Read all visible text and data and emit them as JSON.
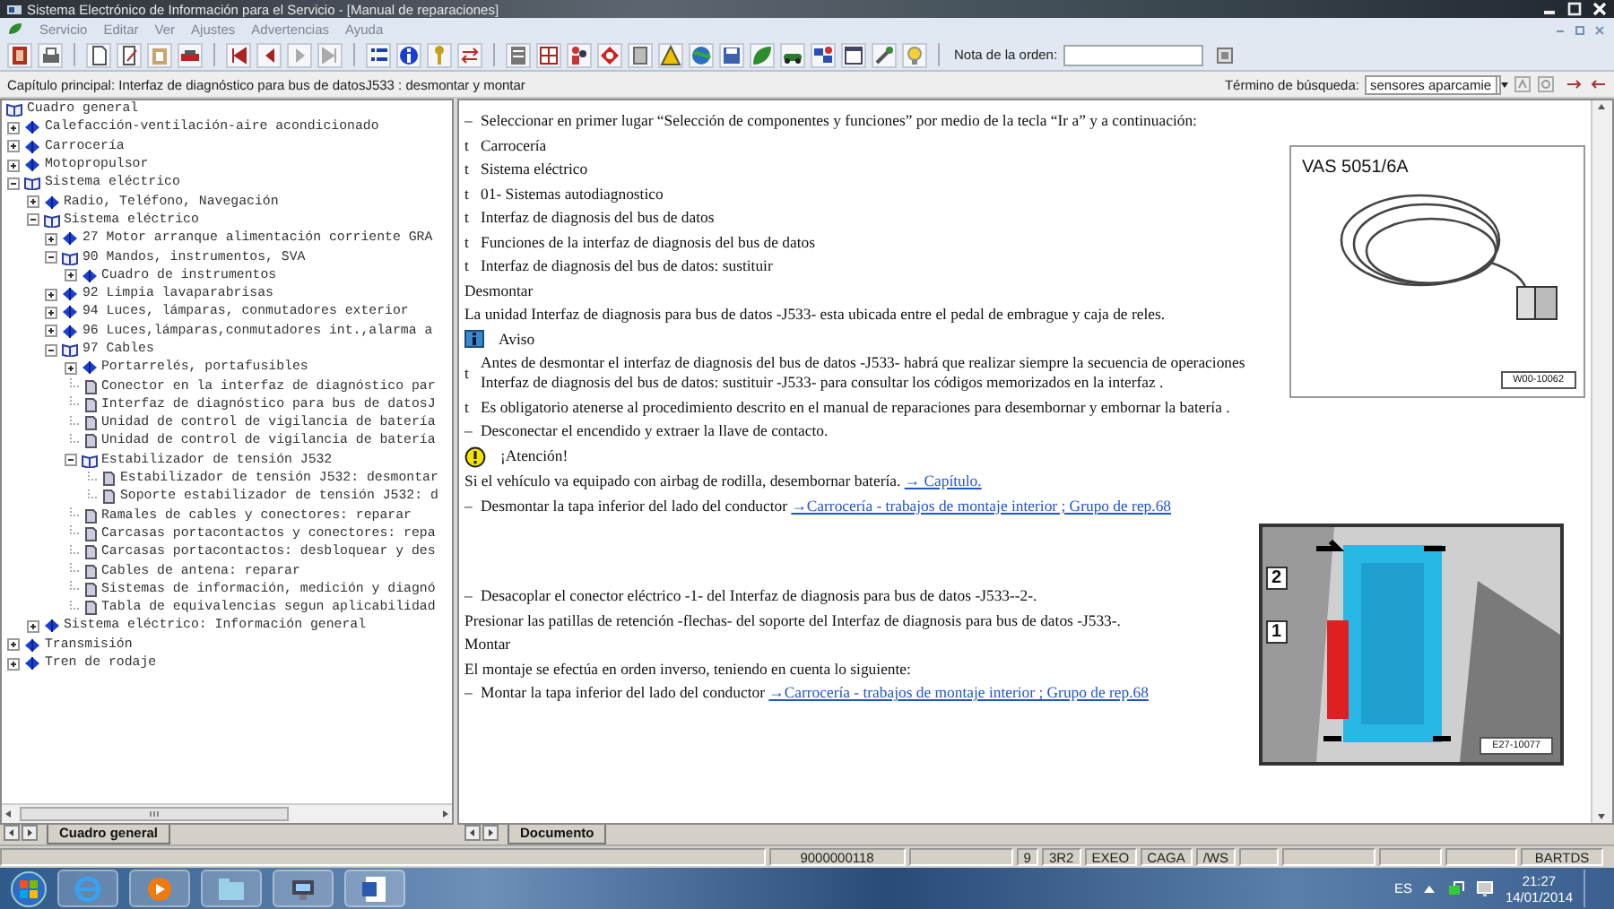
{
  "window": {
    "title": "Sistema Electrónico de Información para el Servicio - [Manual de reparaciones]"
  },
  "menu": [
    "Servicio",
    "Editar",
    "Ver",
    "Ajustes",
    "Advertencias",
    "Ayuda"
  ],
  "toolbar": {
    "order_note_label": "Nota de la orden:"
  },
  "chapter_bar": {
    "text": "Capítulo principal: Interfaz de diagnóstico para bus de datosJ533 : desmontar y montar",
    "search_label": "Término de búsqueda:",
    "search_value": "sensores aparcamie"
  },
  "tree": [
    {
      "label": "Cuadro general",
      "kind": "folder",
      "expanded": true,
      "children": [
        {
          "label": "Calefacción-ventilación-aire acondicionado",
          "kind": "folder",
          "expanded": false
        },
        {
          "label": "Carrocería",
          "kind": "folder",
          "expanded": false
        },
        {
          "label": "Motopropulsor",
          "kind": "folder",
          "expanded": false
        },
        {
          "label": "Sistema eléctrico",
          "kind": "folder",
          "expanded": true,
          "children": [
            {
              "label": "Radio, Teléfono, Navegación",
              "kind": "folder",
              "expanded": false
            },
            {
              "label": "Sistema eléctrico",
              "kind": "folder",
              "expanded": true,
              "children": [
                {
                  "label": "27 Motor arranque alimentación corriente GRA",
                  "kind": "folder",
                  "expanded": false
                },
                {
                  "label": "90 Mandos, instrumentos, SVA",
                  "kind": "folder",
                  "expanded": true,
                  "children": [
                    {
                      "label": "Cuadro de instrumentos",
                      "kind": "folder",
                      "expanded": false
                    }
                  ]
                },
                {
                  "label": "92 Limpia lavaparabrisas",
                  "kind": "folder",
                  "expanded": false
                },
                {
                  "label": "94 Luces, lámparas, conmutadores exterior",
                  "kind": "folder",
                  "expanded": false
                },
                {
                  "label": "96 Luces,lámparas,conmutadores int.,alarma a",
                  "kind": "folder",
                  "expanded": false
                },
                {
                  "label": "97 Cables",
                  "kind": "folder",
                  "expanded": true,
                  "children": [
                    {
                      "label": "Portarrelés, portafusibles",
                      "kind": "folder",
                      "expanded": false
                    },
                    {
                      "label": "Conector en la interfaz de diagnóstico par",
                      "kind": "page"
                    },
                    {
                      "label": "Interfaz de diagnóstico para bus de datosJ",
                      "kind": "page"
                    },
                    {
                      "label": "Unidad de control de vigilancia de batería",
                      "kind": "page"
                    },
                    {
                      "label": "Unidad de control de vigilancia de batería",
                      "kind": "page"
                    },
                    {
                      "label": "Estabilizador de tensión J532",
                      "kind": "folder",
                      "expanded": true,
                      "children": [
                        {
                          "label": "Estabilizador de tensión J532: desmontar",
                          "kind": "page"
                        },
                        {
                          "label": "Soporte estabilizador de tensión J532: d",
                          "kind": "page"
                        }
                      ]
                    },
                    {
                      "label": "Ramales de cables y conectores: reparar",
                      "kind": "page"
                    },
                    {
                      "label": "Carcasas portacontactos y conectores: repa",
                      "kind": "page"
                    },
                    {
                      "label": "Carcasas portacontactos: desbloquear y des",
                      "kind": "page"
                    },
                    {
                      "label": "Cables de antena: reparar",
                      "kind": "page"
                    },
                    {
                      "label": "Sistemas de información, medición y diagnó",
                      "kind": "page"
                    },
                    {
                      "label": "Tabla de equivalencias segun aplicabilidad",
                      "kind": "page"
                    }
                  ]
                }
              ]
            },
            {
              "label": "Sistema eléctrico: Información general",
              "kind": "folder",
              "expanded": false
            }
          ]
        },
        {
          "label": "Transmisión",
          "kind": "folder",
          "expanded": false
        },
        {
          "label": "Tren de rodaje",
          "kind": "folder",
          "expanded": false
        }
      ]
    }
  ],
  "document": {
    "blocks": [
      {
        "kind": "dash",
        "marker": "–",
        "text": "Seleccionar en primer lugar “Selección de componentes y funciones” por medio de la tecla “Ir a” y a continuación:"
      },
      {
        "kind": "bullet",
        "marker": "t",
        "text": "Carrocería"
      },
      {
        "kind": "bullet",
        "marker": "t",
        "text": "Sistema eléctrico"
      },
      {
        "kind": "bullet",
        "marker": "t",
        "text": "01- Sistemas autodiagnostico"
      },
      {
        "kind": "bullet",
        "marker": "t",
        "text": "Interfaz de diagnosis del bus de datos"
      },
      {
        "kind": "bullet",
        "marker": "t",
        "text": "Funciones de la interfaz de diagnosis del bus de datos"
      },
      {
        "kind": "bullet",
        "marker": "t",
        "text": "Interfaz de diagnosis del bus de datos: sustituir"
      },
      {
        "kind": "plain",
        "text": "Desmontar"
      },
      {
        "kind": "plain",
        "text": "La unidad Interfaz de diagnosis para bus de datos -J533- esta ubicada entre el pedal de embrague y caja de reles."
      },
      {
        "kind": "notice",
        "text": "Aviso"
      },
      {
        "kind": "bullet",
        "marker": "t",
        "text": "Antes de desmontar el interfaz de diagnosis del bus de datos -J533- habrá que realizar siempre la secuencia de operaciones Interfaz de diagnosis del bus de datos: sustituir -J533- para consultar los códigos memorizados en la interfaz ."
      },
      {
        "kind": "bullet",
        "marker": "t",
        "text": "Es obligatorio atenerse al procedimiento descrito en el manual de reparaciones para desembornar y embornar la batería ."
      },
      {
        "kind": "dash",
        "marker": "–",
        "text": "Desconectar el encendido y extraer la llave de contacto."
      },
      {
        "kind": "caution",
        "text": "¡Atención!"
      },
      {
        "kind": "plain",
        "text": "Si el vehículo va equipado con airbag de rodilla, desembornar batería.",
        "link": "→ Capítulo."
      },
      {
        "kind": "dash",
        "marker": "–",
        "text": "Desmontar la tapa inferior del lado del conductor",
        "link": "→Carrocería - trabajos de montaje interior ; Grupo de rep.68"
      },
      {
        "kind": "dash",
        "marker": "–",
        "text": "Desacoplar el conector eléctrico -1- del Interfaz de diagnosis para bus de datos -J533--2-."
      },
      {
        "kind": "plain",
        "text": "Presionar las patillas de retención -flechas- del soporte del Interfaz de diagnosis para bus de datos -J533-."
      },
      {
        "kind": "plain",
        "text": "Montar"
      },
      {
        "kind": "plain",
        "text": "El montaje se efectúa en orden inverso, teniendo en cuenta lo siguiente:"
      },
      {
        "kind": "dash",
        "marker": "–",
        "text": "Montar la tapa inferior del lado del conductor",
        "link": "→Carrocería - trabajos de montaje interior ; Grupo de rep.68"
      }
    ],
    "figures": [
      {
        "kind": "cable",
        "title": "VAS 5051/6A",
        "code": "W00-10062"
      },
      {
        "kind": "module",
        "callouts": [
          "2",
          "1"
        ],
        "code": "E27-10077"
      }
    ]
  },
  "tabs_left": [
    {
      "label": "Cuadro general",
      "selected": true
    }
  ],
  "tabs_right": [
    {
      "label": "Documento",
      "selected": true
    }
  ],
  "status_bar": [
    "9000000118",
    "9",
    "3R2",
    "EXEO",
    "CAGA",
    "/WS",
    "BARTDS"
  ],
  "taskbar": {
    "language": "ES",
    "time": "21:27",
    "date": "14/01/2014"
  }
}
